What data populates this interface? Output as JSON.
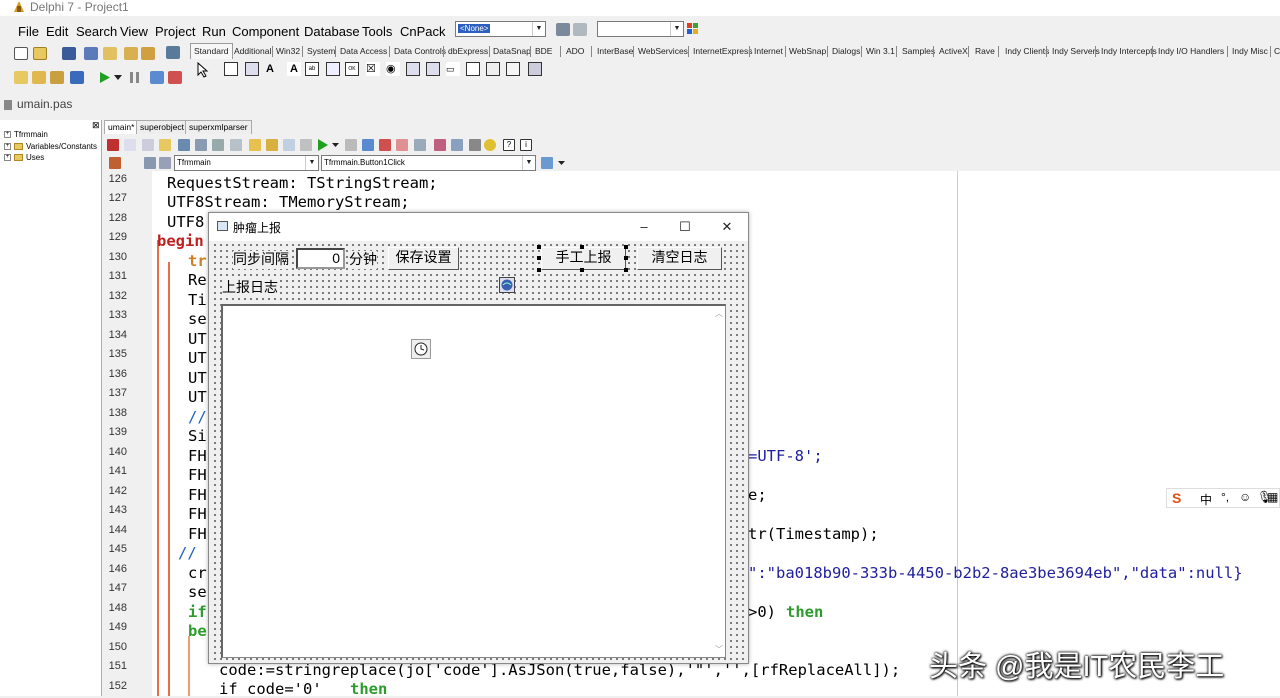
{
  "window": {
    "title": "Delphi 7 - Project1"
  },
  "menu": [
    "File",
    "Edit",
    "Search",
    "View",
    "Project",
    "Run",
    "Component",
    "Database",
    "Tools",
    "CnPack"
  ],
  "toolbar": {
    "component_combo": "<None>",
    "desk_combo": ""
  },
  "palette_tabs": [
    "Standard",
    "Additional",
    "Win32",
    "System",
    "Data Access",
    "Data Controls",
    "dbExpress",
    "DataSnap",
    "BDE",
    "ADO",
    "InterBase",
    "WebServices",
    "InternetExpress",
    "Internet",
    "WebSnap",
    "Dialogs",
    "Win 3.1",
    "Samples",
    "ActiveX",
    "Rave",
    "Indy Clients",
    "Indy Servers",
    "Indy Intercepts",
    "Indy I/O Handlers",
    "Indy Misc",
    "C"
  ],
  "file_tab": "umain.pas",
  "tree": [
    "Tfrmmain",
    "Variables/Constants",
    "Uses"
  ],
  "editor_tabs": [
    "umain*",
    "superobject",
    "superxmlparser"
  ],
  "editor_combos": {
    "class": "Tfrmmain",
    "method": "Tfrmmain.Button1Click"
  },
  "line_numbers": [
    "126",
    "127",
    "128",
    "129",
    "130",
    "131",
    "132",
    "133",
    "134",
    "135",
    "136",
    "137",
    "138",
    "139",
    "140",
    "141",
    "142",
    "143",
    "144",
    "145",
    "146",
    "147",
    "148",
    "149",
    "150",
    "151",
    "152"
  ],
  "code": {
    "l126": "RequestStream: TStringStream;",
    "l127": "UTF8Stream: TMemoryStream;",
    "l128": "UTF8",
    "l129": "begin",
    "l130": "tr",
    "l131": "Re",
    "l132": "Ti",
    "l133": "se",
    "l134": "UT",
    "l135": "UT",
    "l136": "UT",
    "l137": "UT",
    "l138": "//",
    "l139": "Si",
    "l140a": "FH",
    "l140b": "=UTF-8';",
    "l141": "FH",
    "l142a": "FH",
    "l142b": "e;",
    "l143": "FH",
    "l144a": "FH",
    "l144b": "tr(Timestamp);",
    "l145": "//",
    "l146a": "cr",
    "l146b": "\":\"ba018b90-333b-4450-b2b2-8ae3be3694eb\",\"data\":null}",
    "l147": "se",
    "l148a": "if",
    "l148b": ">0)",
    "l148c": "then",
    "l149": "be",
    "l151": "code:=stringreplace(jo['code'].AsJSon(true,false),'\"','',[rfReplaceAll]);",
    "l152a": "if code='0'",
    "l152b": "then"
  },
  "form": {
    "title": "肿瘤上报",
    "interval_label": "同步间隔",
    "interval_value": "0",
    "minute_label": "分钟",
    "save_button": "保存设置",
    "manual_button": "手工上报",
    "clear_button": "清空日志",
    "log_label": "上报日志"
  },
  "ime": {
    "text": "中"
  },
  "watermark": "头条 @我是IT农民李工"
}
